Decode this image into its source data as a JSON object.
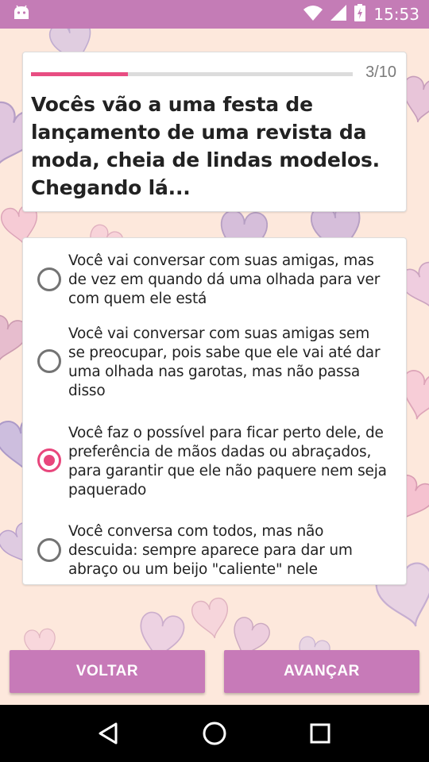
{
  "status_bar": {
    "time": "15:53",
    "icons": [
      "android-icon",
      "wifi-icon",
      "cellular-signal-icon",
      "battery-charging-icon"
    ]
  },
  "quiz": {
    "progress": {
      "current": 3,
      "total": 10,
      "label": "3/10",
      "fraction": 0.3,
      "color": "#e84d82"
    },
    "question_lines": [
      "Vocês vão a uma festa de",
      "lançamento de uma revista da",
      "moda, cheia de lindas modelos.",
      "Chegando lá..."
    ],
    "options": [
      {
        "lines": [
          "Você vai conversar com suas amigas, mas",
          "de vez em quando dá uma olhada para ver",
          "com quem ele está"
        ],
        "selected": false
      },
      {
        "lines": [
          "Você vai conversar com suas amigas sem",
          "se preocupar, pois sabe que ele vai até dar",
          "uma olhada nas garotas, mas não passa",
          "disso"
        ],
        "selected": false
      },
      {
        "lines": [
          "Você faz o possível para ficar perto dele, de",
          "preferência de mãos dadas ou abraçados,",
          "para garantir que ele não paquere nem seja",
          "paquerado"
        ],
        "selected": true
      },
      {
        "lines": [
          "Você conversa com todos, mas não",
          "descuida: sempre aparece para dar um",
          "abraço ou um beijo \"caliente\" nele"
        ],
        "selected": false
      }
    ]
  },
  "buttons": {
    "back_label": "VOLTAR",
    "next_label": "AVANÇAR"
  },
  "nav_bar": {
    "icons": [
      "back-triangle-icon",
      "home-circle-icon",
      "recents-square-icon"
    ]
  },
  "colors": {
    "status_bar": "#c47cb6",
    "accent": "#e8467c",
    "button": "#c77ab8",
    "background": "#fde8dc"
  }
}
